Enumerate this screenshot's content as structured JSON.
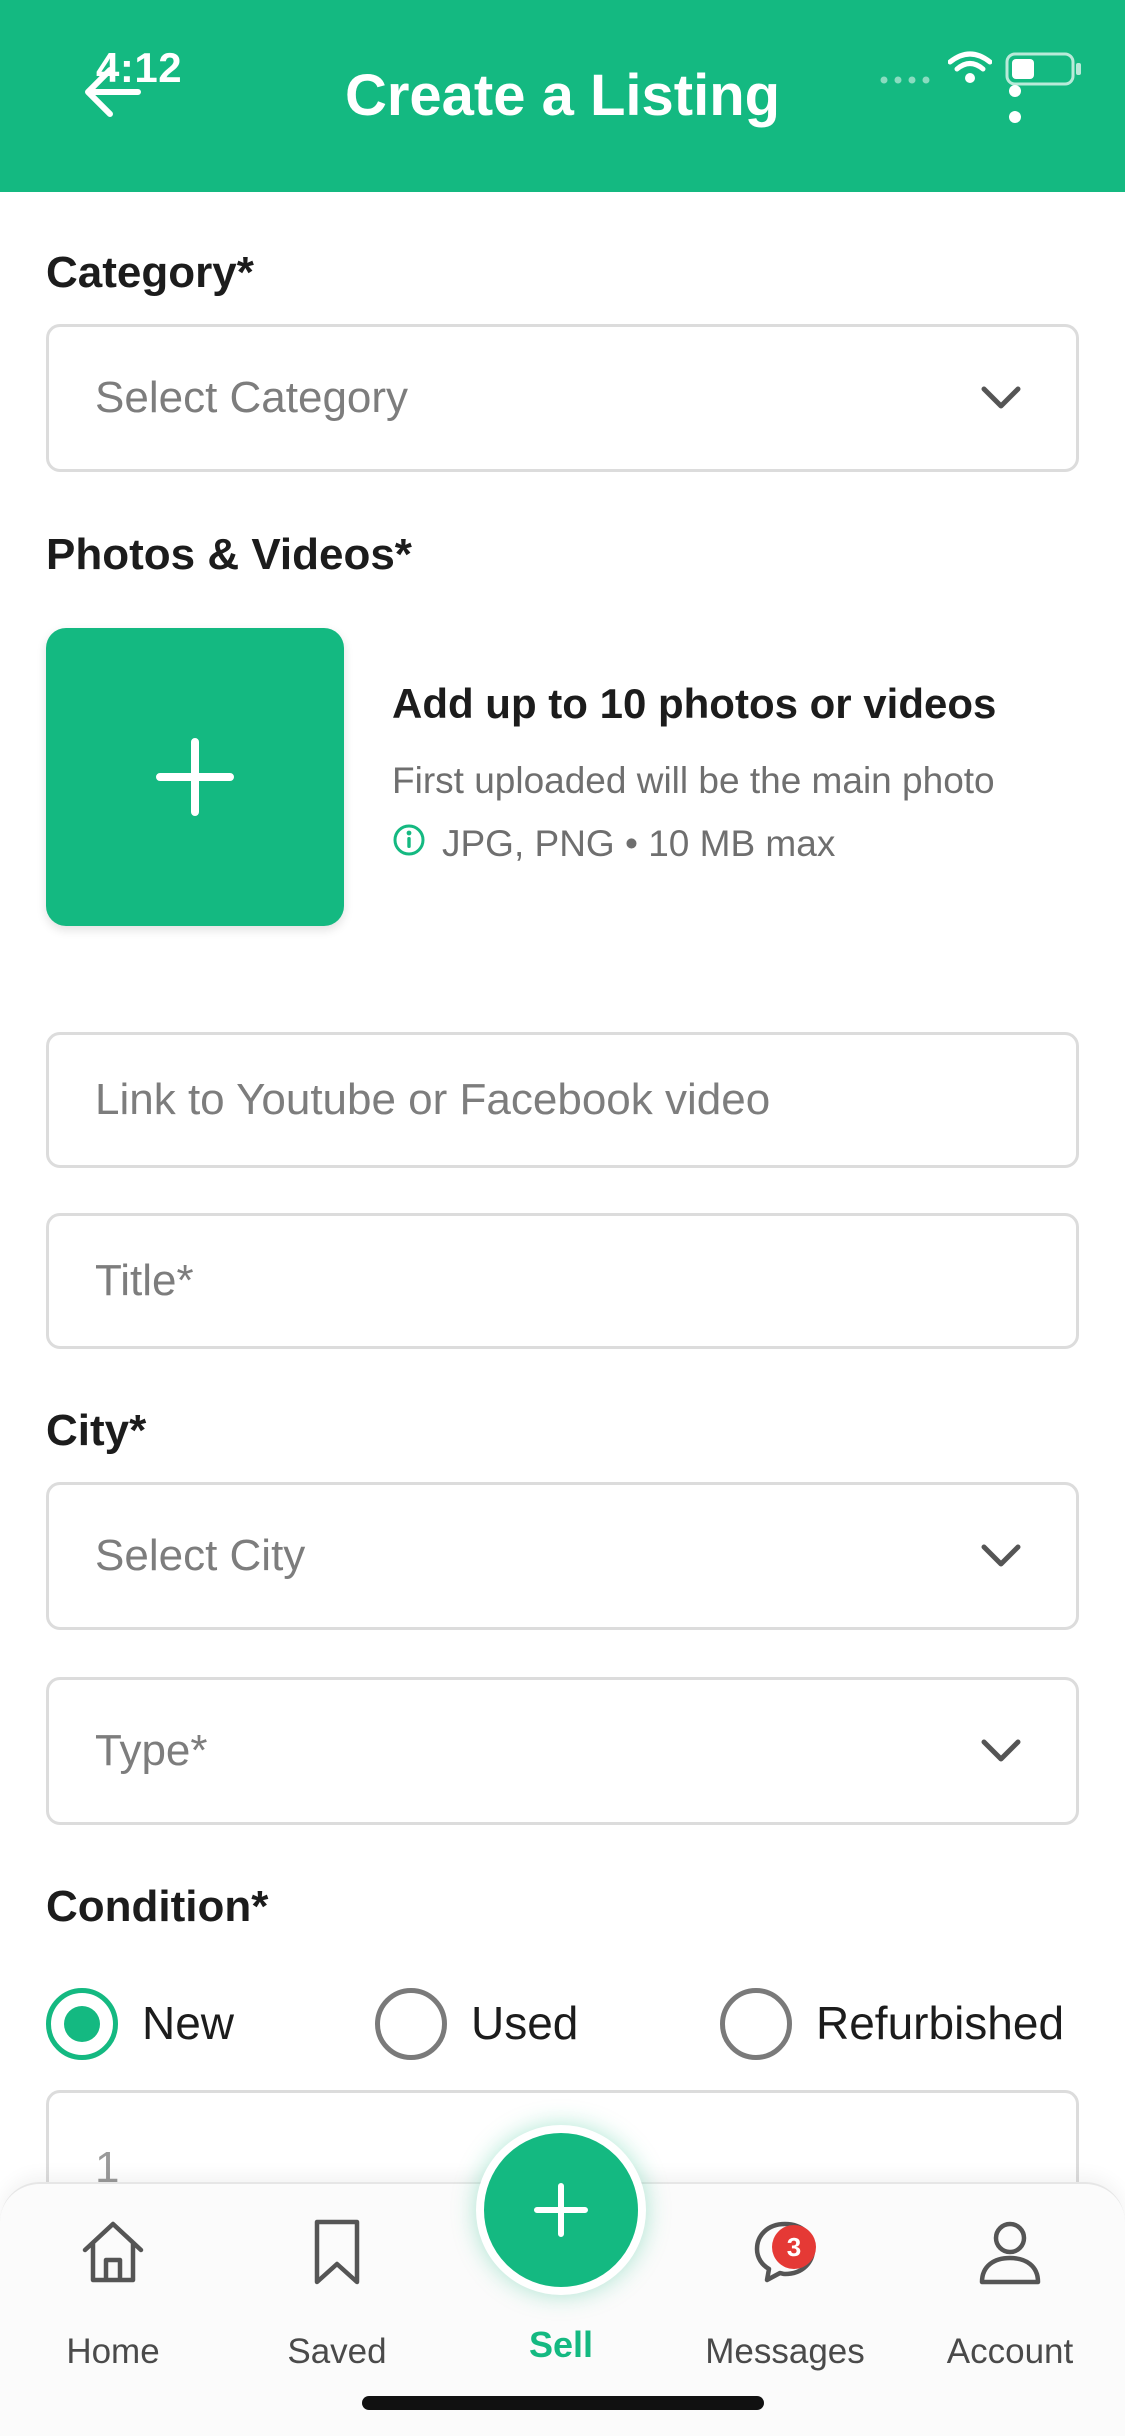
{
  "status_bar": {
    "time": "4:12"
  },
  "header": {
    "title": "Create a Listing",
    "back_icon": "arrow-left-icon",
    "more_icon": "more-vertical-icon"
  },
  "colors": {
    "brand": "#14b981",
    "badge": "#e53935"
  },
  "form": {
    "category_label": "Category*",
    "category_placeholder": "Select Category",
    "photos_label": "Photos & Videos*",
    "upload_title": "Add up to 10 photos or videos",
    "upload_subtitle": "First uploaded will be the main photo",
    "upload_formats": "JPG, PNG • 10 MB max",
    "video_link_placeholder": "Link to Youtube or Facebook video",
    "title_placeholder": "Title*",
    "city_label": "City*",
    "city_placeholder": "Select City",
    "type_placeholder": "Type*",
    "condition_label": "Condition*",
    "condition_options": [
      {
        "label": "New",
        "selected": true
      },
      {
        "label": "Used",
        "selected": false
      },
      {
        "label": "Refurbished",
        "selected": false
      }
    ],
    "quantity_value": "1"
  },
  "tabbar": {
    "items": [
      {
        "label": "Home",
        "icon": "home-icon"
      },
      {
        "label": "Saved",
        "icon": "bookmark-icon"
      },
      {
        "label": "Sell",
        "icon": "plus-icon"
      },
      {
        "label": "Messages",
        "icon": "chat-icon",
        "badge": "3"
      },
      {
        "label": "Account",
        "icon": "user-icon"
      }
    ]
  }
}
